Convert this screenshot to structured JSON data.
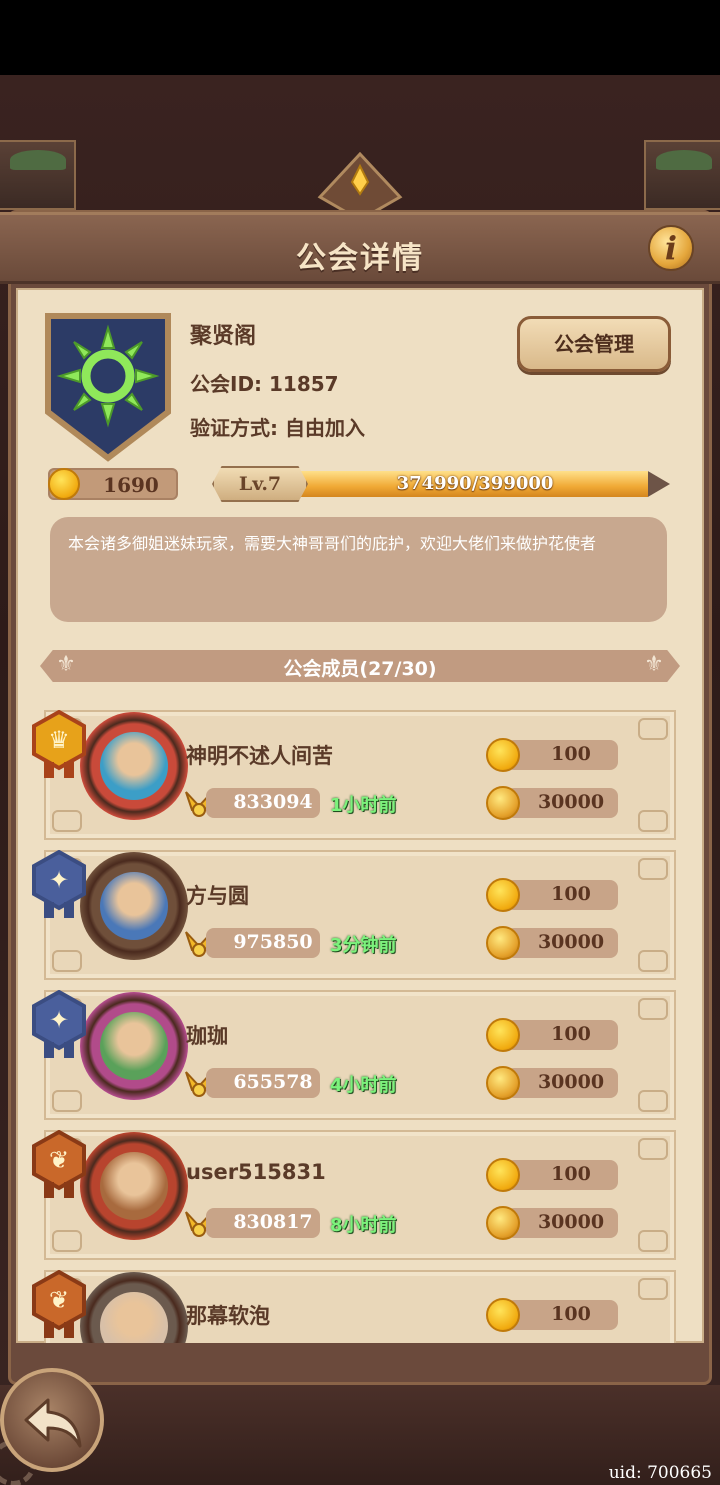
{
  "header": {
    "title": "公会详情"
  },
  "guild": {
    "name": "聚贤阁",
    "id_label": "公会ID: 11857",
    "verify_label": "验证方式: 自由加入",
    "manage_label": "公会管理",
    "gold": "1690",
    "level": "Lv.7",
    "xp_text": "374990/399000",
    "xp_fraction": 0.94,
    "description": "本会诸多御姐迷妹玩家，需要大神哥哥们的庇护，欢迎大佬们来做护花使者"
  },
  "members_title": "公会成员(27/30)",
  "members": [
    {
      "name": "神明不述人间苦",
      "rank": "leader",
      "power": "833094",
      "last_seen": "1小时前",
      "contribution": "100",
      "donation": "30000"
    },
    {
      "name": "方与圆",
      "rank": "officer",
      "power": "975850",
      "last_seen": "3分钟前",
      "contribution": "100",
      "donation": "30000"
    },
    {
      "name": "珈珈",
      "rank": "officer",
      "power": "655578",
      "last_seen": "4小时前",
      "contribution": "100",
      "donation": "30000"
    },
    {
      "name": "user515831",
      "rank": "member",
      "power": "830817",
      "last_seen": "8小时前",
      "contribution": "100",
      "donation": "30000"
    },
    {
      "name": "那幕软泡",
      "rank": "member",
      "power": "",
      "last_seen": "",
      "contribution": "100",
      "donation": ""
    }
  ],
  "footer": {
    "uid": "uid: 700665"
  },
  "colors": {
    "parchment": "#eedfc3",
    "frame": "#6b4a3c",
    "online_green": "#7cf27c",
    "gold": "#f1aa0f"
  }
}
